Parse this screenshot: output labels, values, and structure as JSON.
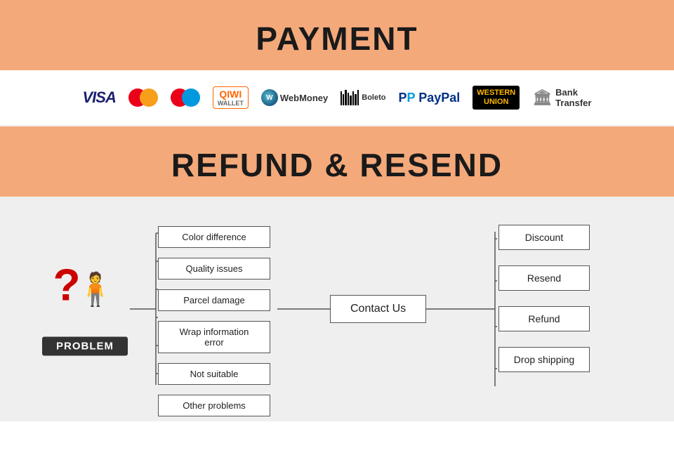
{
  "payment": {
    "title": "PAYMENT",
    "logos": [
      {
        "id": "visa",
        "label": "VISA"
      },
      {
        "id": "mastercard",
        "label": "MasterCard"
      },
      {
        "id": "maestro",
        "label": "Maestro"
      },
      {
        "id": "qiwi",
        "label": "QIWI WALLET"
      },
      {
        "id": "webmoney",
        "label": "WebMoney"
      },
      {
        "id": "boleto",
        "label": "Boleto"
      },
      {
        "id": "paypal",
        "label": "PayPal"
      },
      {
        "id": "westernunion",
        "label": "WESTERN UNION"
      },
      {
        "id": "bank",
        "label": "Bank Transfer"
      }
    ]
  },
  "refund": {
    "title": "REFUND & RESEND"
  },
  "diagram": {
    "problem_label": "PROBLEM",
    "problems": [
      "Color difference",
      "Quality issues",
      "Parcel damage",
      "Wrap information error",
      "Not suitable",
      "Other problems"
    ],
    "contact": "Contact Us",
    "solutions": [
      "Discount",
      "Resend",
      "Refund",
      "Drop shipping"
    ]
  }
}
